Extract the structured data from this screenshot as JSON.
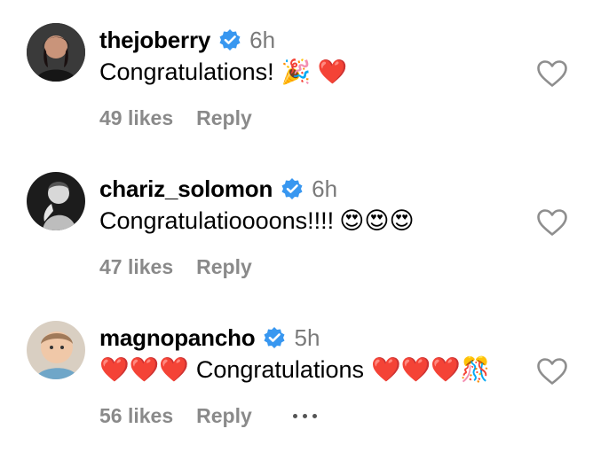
{
  "comments": [
    {
      "username": "thejoberry",
      "time": "6h",
      "text": "Congratulations!",
      "emoji": "🎉 ❤️",
      "likes": "49 likes",
      "reply": "Reply"
    },
    {
      "username": "chariz_solomon",
      "time": "6h",
      "text": "Congratulatioooons!!!!",
      "emoji": "😍😍😍",
      "likes": "47 likes",
      "reply": "Reply"
    },
    {
      "username": "magnopancho",
      "time": "5h",
      "emoji_before": "❤️❤️❤️",
      "text": "Congratulations",
      "emoji": "❤️❤️❤️🎊",
      "likes": "56 likes",
      "reply": "Reply"
    }
  ],
  "colors": {
    "verified": "#3897f0",
    "meta": "#8a8a8a",
    "time": "#7a7a7a",
    "heart_outline": "#8e8e8e"
  },
  "icons": {
    "verified": "verified-badge-icon",
    "like": "heart-outline-icon",
    "more": "more-dots-icon"
  }
}
